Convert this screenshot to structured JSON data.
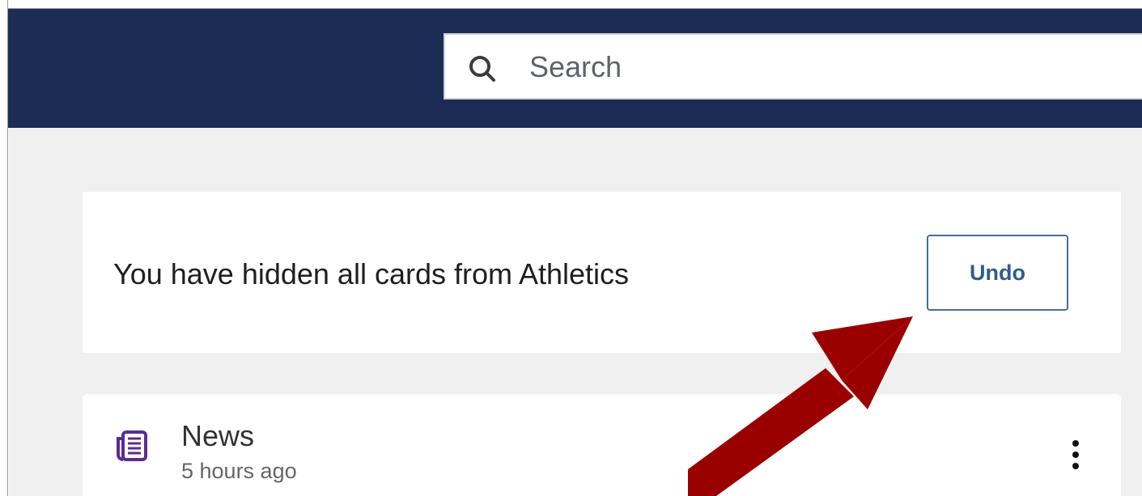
{
  "colors": {
    "header_bg": "#1b2d55",
    "page_bg": "#f0f0f0",
    "card_bg": "#ffffff",
    "accent_blue": "#2f5d8c",
    "news_icon_purple": "#5b2d91",
    "arrow_red": "#9b0000"
  },
  "search": {
    "placeholder": "Search",
    "icon": "search-icon"
  },
  "banner": {
    "message": "You have hidden all cards from Athletics",
    "undo_label": "Undo"
  },
  "news_card": {
    "icon": "newspaper-icon",
    "title": "News",
    "timestamp": "5 hours ago",
    "menu_icon": "more-vert-icon"
  }
}
